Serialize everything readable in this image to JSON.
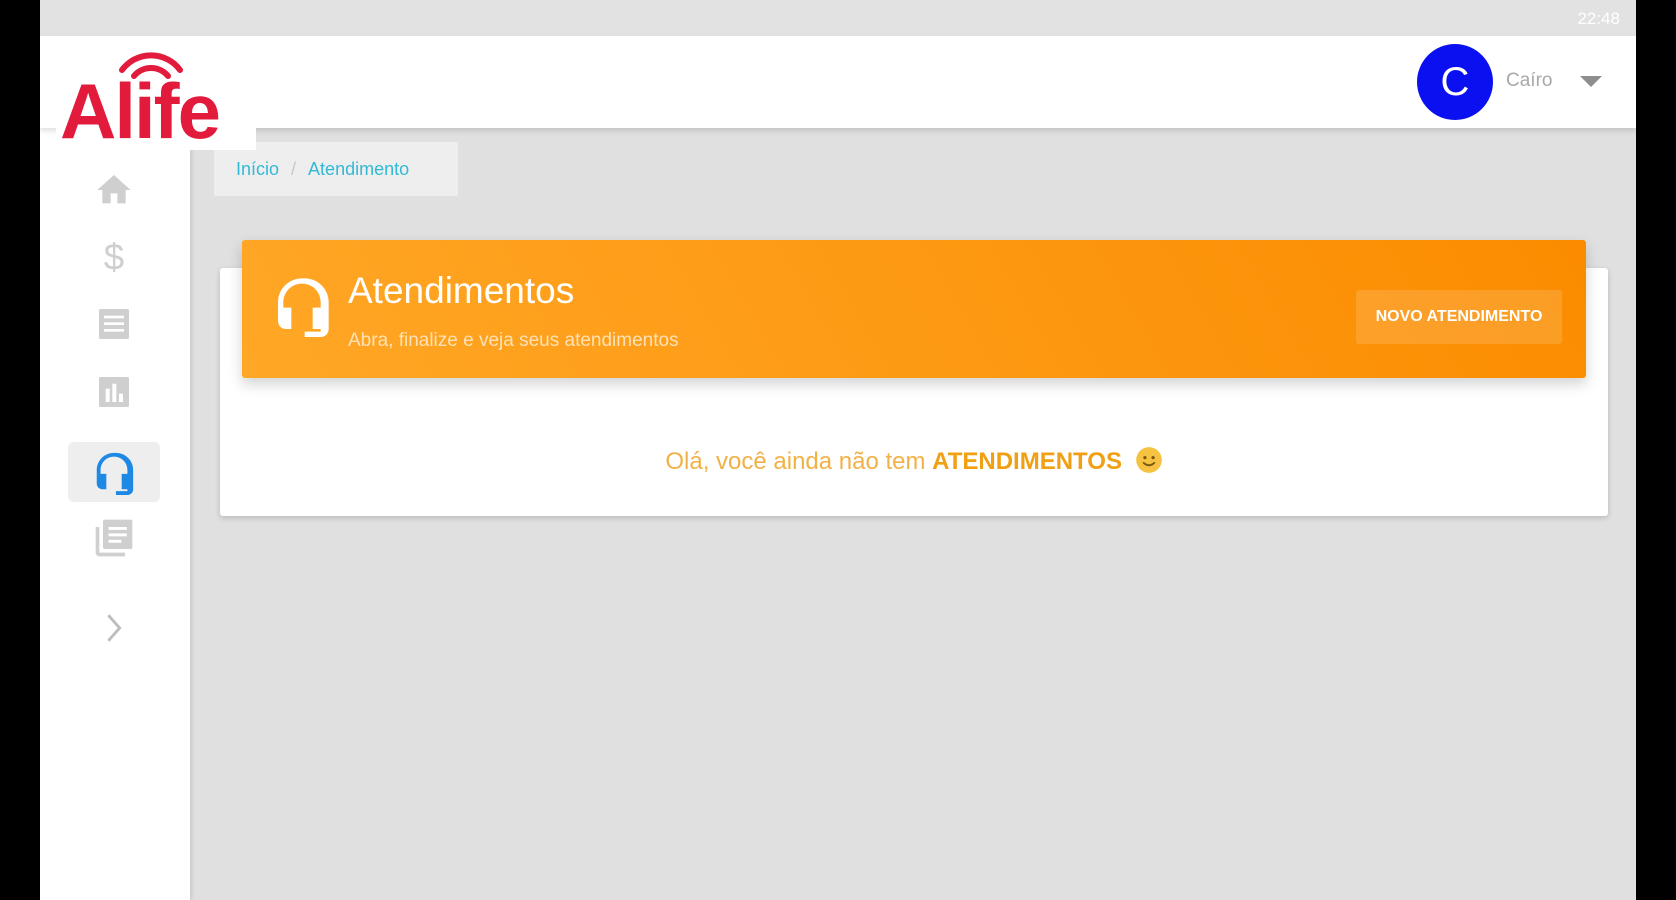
{
  "status_bar": {
    "time": "22:48"
  },
  "brand": {
    "logo_text": "Alife",
    "color": "#e21b3c"
  },
  "user": {
    "initial": "C",
    "name": "Caíro",
    "avatar_color": "#0a10f0"
  },
  "sidebar": {
    "items": [
      {
        "icon": "home-icon",
        "active": false
      },
      {
        "icon": "dollar-icon",
        "active": false
      },
      {
        "icon": "list-icon",
        "active": false
      },
      {
        "icon": "bar-chart-icon",
        "active": false
      },
      {
        "icon": "headset-icon",
        "active": true
      },
      {
        "icon": "library-books-icon",
        "active": false
      },
      {
        "icon": "chevron-right-icon",
        "active": false
      }
    ]
  },
  "breadcrumb": {
    "items": [
      "Início",
      "Atendimento"
    ]
  },
  "banner": {
    "title": "Atendimentos",
    "subtitle": "Abra, finalize e veja seus atendimentos",
    "button_label": "NOVO ATENDIMENTO",
    "color_start": "#ffa726",
    "color_end": "#fb8c00"
  },
  "empty_state": {
    "text_before": "Olá, você ainda não tem",
    "highlight": "ATENDIMENTOS"
  },
  "colors": {
    "accent_blue": "#1e88e5",
    "link": "#33b9d6"
  }
}
